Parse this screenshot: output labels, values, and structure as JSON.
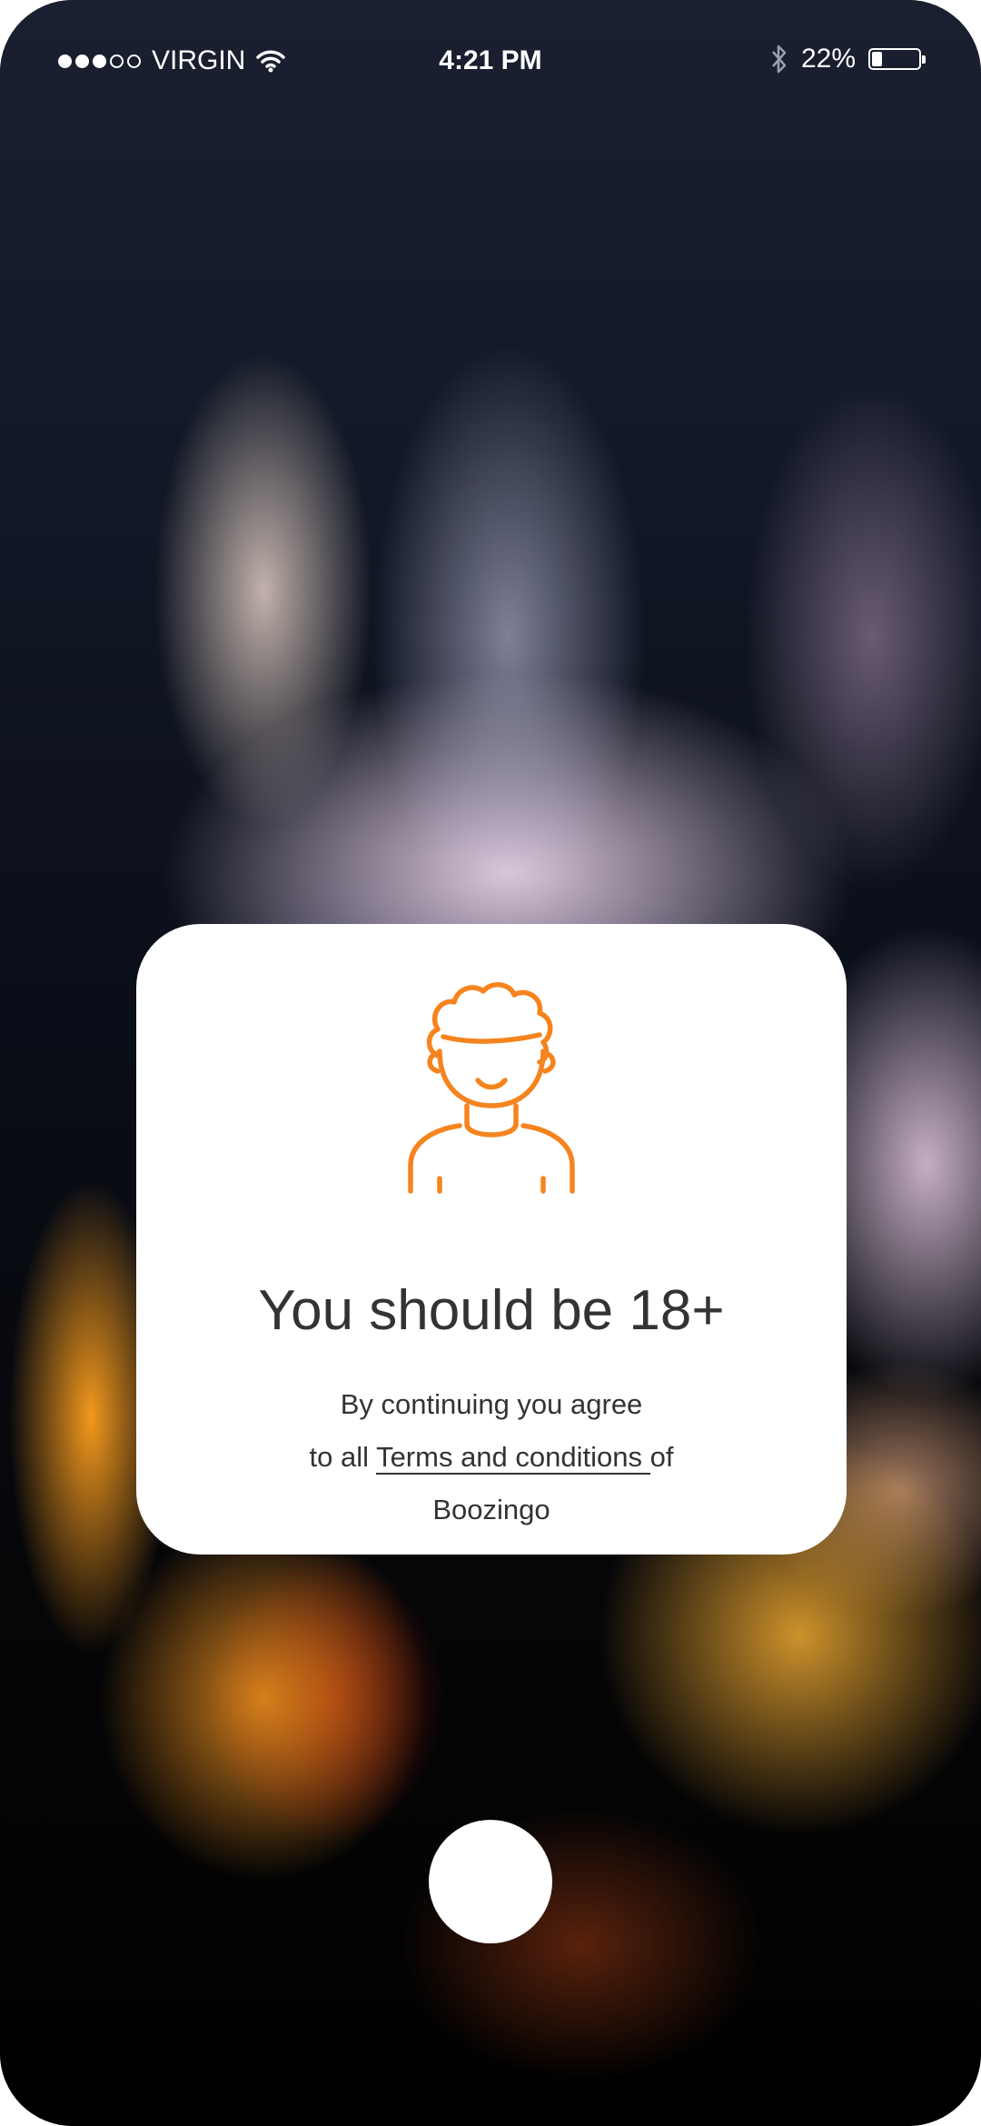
{
  "status_bar": {
    "carrier": "VIRGIN",
    "time": "4:21 PM",
    "battery_percent": "22%",
    "battery_level": 0.22,
    "signal_bars_filled": 3,
    "signal_bars_total": 5,
    "icons": [
      "signal-dots-icon",
      "wifi-icon",
      "bluetooth-icon",
      "battery-icon"
    ]
  },
  "age_gate": {
    "icon": "person-avatar-icon",
    "title": "You should be 18+",
    "line1": "By continuing you agree",
    "line2_prefix": "to all ",
    "terms_link": "Terms and conditions ",
    "line2_suffix": "of",
    "line3": "Boozingo",
    "accent_color": "#F5841F"
  },
  "home_button": {
    "icon": "home-button"
  }
}
